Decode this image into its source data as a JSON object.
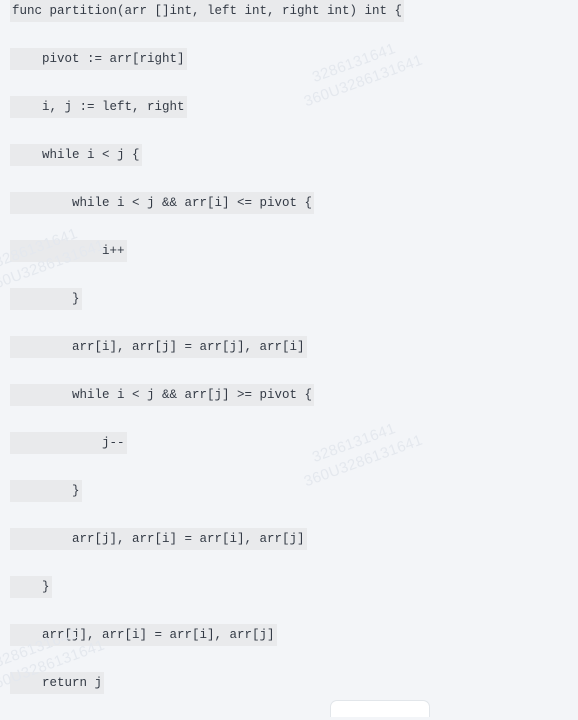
{
  "page": {
    "background_color": "#f3f5f8",
    "line_highlight_color": "#e9eaec",
    "code_text_color": "#333a45",
    "watermark_color": "#e4e8ee"
  },
  "watermark": {
    "line1": "3286131641",
    "line2": "360U3286131641"
  },
  "code": {
    "language": "go",
    "lines": [
      {
        "text": "func partition(arr []int, left int, right int) int {"
      },
      {
        "text": "    pivot := arr[right]"
      },
      {
        "text": "    i, j := left, right"
      },
      {
        "text": "    while i < j {"
      },
      {
        "text": "        while i < j && arr[i] <= pivot {"
      },
      {
        "text": "            i++"
      },
      {
        "text": "        }"
      },
      {
        "text": "        arr[i], arr[j] = arr[j], arr[i]"
      },
      {
        "text": "        while i < j && arr[j] >= pivot {"
      },
      {
        "text": "            j--"
      },
      {
        "text": "        }"
      },
      {
        "text": "        arr[j], arr[i] = arr[i], arr[j]"
      },
      {
        "text": "    }"
      },
      {
        "text": "    arr[j], arr[i] = arr[i], arr[j]"
      },
      {
        "text": "    return j"
      }
    ]
  },
  "bottom_sheet": {
    "label": ""
  }
}
